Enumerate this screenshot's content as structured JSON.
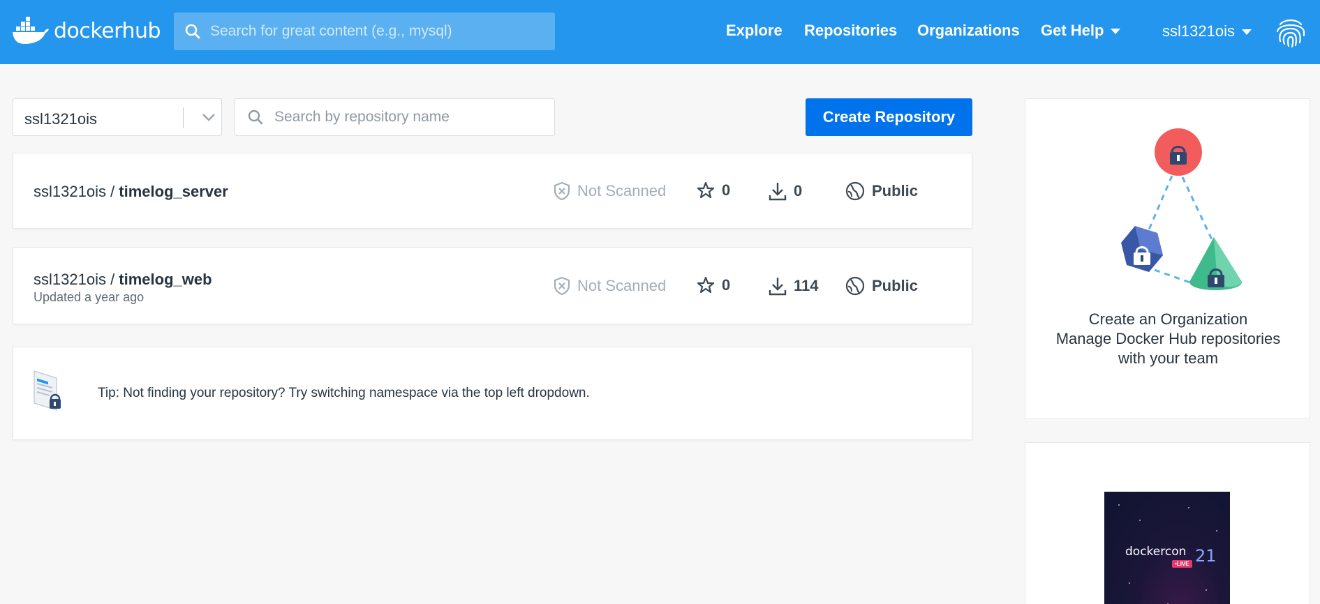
{
  "header": {
    "logo_text_a": "docker",
    "logo_text_b": "hub",
    "search_placeholder": "Search for great content (e.g., mysql)",
    "nav": {
      "explore": "Explore",
      "repositories": "Repositories",
      "organizations": "Organizations",
      "get_help": "Get Help"
    },
    "username": "ssl1321ois",
    "brand_color": "#2496ed"
  },
  "controls": {
    "namespace": "ssl1321ois",
    "repo_search_placeholder": "Search by repository name",
    "create_button": "Create Repository",
    "create_button_color": "#0073ec"
  },
  "repos": [
    {
      "namespace": "ssl1321ois",
      "separator": " / ",
      "name": "timelog_server",
      "updated": "",
      "scan_status": "Not Scanned",
      "stars": "0",
      "pulls": "0",
      "visibility": "Public"
    },
    {
      "namespace": "ssl1321ois",
      "separator": " / ",
      "name": "timelog_web",
      "updated": "Updated a year ago",
      "scan_status": "Not Scanned",
      "stars": "0",
      "pulls": "114",
      "visibility": "Public"
    }
  ],
  "tip": {
    "text": "Tip: Not finding your repository? Try switching namespace via the top left dropdown."
  },
  "sidebar": {
    "org_title": "Create an Organization",
    "org_line1": "Manage Docker Hub repositories",
    "org_line2": "with your team",
    "promo_text": "dockercon",
    "promo_live": "•LIVE",
    "promo_year": "21"
  }
}
